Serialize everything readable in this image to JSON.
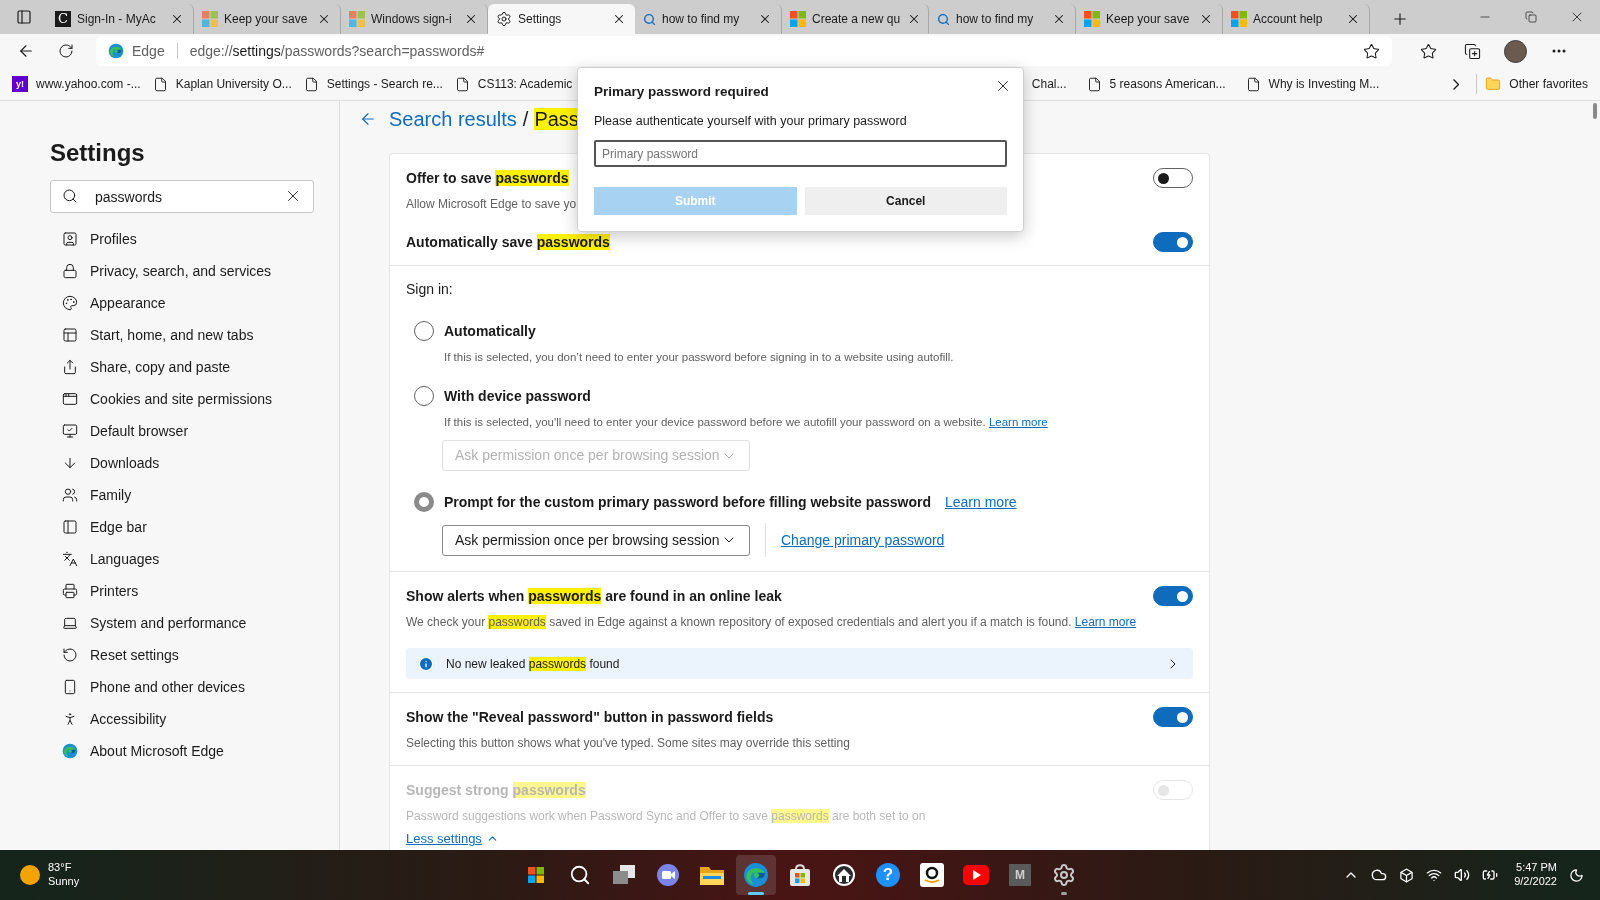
{
  "tabs": [
    {
      "kind": "letter",
      "glyph": "C",
      "title": "Sign-In - MyAc",
      "selected": false
    },
    {
      "kind": "faded-logo",
      "title": "Keep your save",
      "selected": false
    },
    {
      "kind": "faded-logo",
      "title": "Windows sign-i",
      "selected": false
    },
    {
      "kind": "settings",
      "title": "Settings",
      "selected": true
    },
    {
      "kind": "search",
      "title": "how to find my",
      "selected": false
    },
    {
      "kind": "logo",
      "title": "Create a new qu",
      "selected": false
    },
    {
      "kind": "search",
      "title": "how to find my",
      "selected": false
    },
    {
      "kind": "logo",
      "title": "Keep your save",
      "selected": false
    },
    {
      "kind": "logo",
      "title": "Account help",
      "selected": false
    }
  ],
  "address_bar": {
    "site_label": "Edge",
    "url": {
      "scheme": "edge://",
      "host": "settings",
      "path": "/passwords?search=passwords#"
    }
  },
  "bookmarks": {
    "left": [
      {
        "kind": "letter",
        "glyph": "y!",
        "title": "www.yahoo.com -..."
      },
      {
        "kind": "page",
        "title": "Kaplan University O..."
      },
      {
        "kind": "page",
        "title": "Settings - Search re..."
      },
      {
        "kind": "page",
        "title": "CS113: Academic"
      }
    ],
    "right": [
      {
        "kind": "plain",
        "title": "Chal..."
      },
      {
        "kind": "page",
        "title": "5 reasons American..."
      },
      {
        "kind": "page",
        "title": "Why is Investing M..."
      }
    ],
    "other": "Other favorites"
  },
  "sidebar": {
    "title": "Settings",
    "search": {
      "value": "passwords"
    },
    "items": [
      {
        "label": "Profiles",
        "selected": false
      },
      {
        "label": "Privacy, search, and services",
        "selected": false
      },
      {
        "label": "Appearance",
        "selected": false
      },
      {
        "label": "Start, home, and new tabs",
        "selected": false
      },
      {
        "label": "Share, copy and paste",
        "selected": false
      },
      {
        "label": "Cookies and site permissions",
        "selected": false
      },
      {
        "label": "Default browser",
        "selected": false
      },
      {
        "label": "Downloads",
        "selected": false
      },
      {
        "label": "Family",
        "selected": false
      },
      {
        "label": "Edge bar",
        "selected": false
      },
      {
        "label": "Languages",
        "selected": false
      },
      {
        "label": "Printers",
        "selected": false
      },
      {
        "label": "System and performance",
        "selected": false
      },
      {
        "label": "Reset settings",
        "selected": false
      },
      {
        "label": "Phone and other devices",
        "selected": false
      },
      {
        "label": "Accessibility",
        "selected": false
      },
      {
        "label": "About Microsoft Edge",
        "selected": false
      }
    ]
  },
  "breadcrumb": {
    "link": "Search results",
    "separator": "/",
    "current": [
      {
        "text": "Pass",
        "highlight": true
      }
    ]
  },
  "sections": [
    {
      "items": [
        {
          "kind": "toggle",
          "disabled": false,
          "on": false,
          "title": [
            {
              "text": "Offer to save ",
              "highlight": false
            },
            {
              "text": "passwords",
              "highlight": true
            }
          ],
          "description": [
            {
              "text": "Allow Microsoft Edge to save yo",
              "highlight": false
            }
          ]
        },
        {
          "kind": "toggle",
          "disabled": false,
          "on": true,
          "title": [
            {
              "text": "Automatically save ",
              "highlight": false
            },
            {
              "text": "passwords",
              "highlight": true
            }
          ]
        }
      ]
    },
    {
      "items": [
        {
          "kind": "signin",
          "heading": "Sign in:",
          "options": [
            {
              "label": "Automatically",
              "selected": false,
              "description": "If this is selected, you don’t need to enter your password before signing in to a website using autofill."
            },
            {
              "label": "With device password",
              "selected": false,
              "description": "If this is selected, you'll need to enter your device password before we autofill your password on a website.",
              "link": "Learn more",
              "dropdown": {
                "value": "Ask permission once per browsing session",
                "disabled": true
              }
            },
            {
              "label": "Prompt for the custom primary password before filling website password",
              "selected": true,
              "link": "Learn more",
              "dropdown": {
                "value": "Ask permission once per browsing session",
                "disabled": false
              },
              "side_link": "Change primary password"
            }
          ]
        }
      ]
    },
    {
      "items": [
        {
          "kind": "toggle",
          "disabled": false,
          "on": true,
          "title": [
            {
              "text": "Show alerts when ",
              "highlight": false
            },
            {
              "text": "passwords",
              "highlight": true
            },
            {
              "text": " are found in an online leak",
              "highlight": false
            }
          ],
          "description": [
            {
              "text": "We check your ",
              "highlight": false
            },
            {
              "text": "passwords",
              "highlight": true
            },
            {
              "text": " saved in Edge against a known repository of exposed credentials and alert you if a match is found. ",
              "highlight": false
            }
          ],
          "link": "Learn more",
          "banner": [
            {
              "text": "No new leaked ",
              "highlight": false
            },
            {
              "text": "passwords",
              "highlight": true
            },
            {
              "text": " found",
              "highlight": false
            }
          ]
        }
      ]
    },
    {
      "items": [
        {
          "kind": "toggle",
          "disabled": false,
          "on": true,
          "title": [
            {
              "text": "Show the \"Reveal password\" button in password fields",
              "highlight": false
            }
          ],
          "description": [
            {
              "text": "Selecting this button shows what you've typed. Some sites may override this setting",
              "highlight": false
            }
          ]
        }
      ]
    },
    {
      "items": [
        {
          "kind": "toggle",
          "disabled": true,
          "on": false,
          "title": [
            {
              "text": "Suggest strong ",
              "highlight": false
            },
            {
              "text": "passwords",
              "highlight": true
            }
          ],
          "description": [
            {
              "text": "Password suggestions work when Password Sync and Offer to save ",
              "highlight": false
            },
            {
              "text": "passwords",
              "highlight": true
            },
            {
              "text": " are both set to on",
              "highlight": false
            }
          ]
        },
        {
          "kind": "link",
          "label": "Less settings"
        }
      ]
    }
  ],
  "dialog": {
    "title": "Primary password required",
    "message": "Please authenticate yourself with your primary password",
    "field": {
      "placeholder": "Primary password"
    },
    "buttons": [
      {
        "label": "Submit",
        "kind": "primary",
        "disabled": true
      },
      {
        "label": "Cancel",
        "kind": "secondary",
        "disabled": false
      }
    ]
  },
  "taskbar": {
    "weather": {
      "temperature": "83°F",
      "condition": "Sunny"
    },
    "apps": [
      {
        "kind": "start",
        "open": false,
        "focused": false
      },
      {
        "kind": "search",
        "open": false,
        "focused": false
      },
      {
        "kind": "taskview",
        "open": false,
        "focused": false
      },
      {
        "kind": "chat",
        "open": false,
        "focused": false
      },
      {
        "kind": "explorer",
        "open": false,
        "focused": false
      },
      {
        "kind": "edge",
        "open": true,
        "focused": true
      },
      {
        "kind": "store",
        "open": false,
        "focused": false
      },
      {
        "kind": "house",
        "open": false,
        "focused": false
      },
      {
        "kind": "help",
        "glyph": "?",
        "open": false,
        "focused": false
      },
      {
        "kind": "amazon",
        "open": false,
        "focused": false
      },
      {
        "kind": "youtube",
        "open": false,
        "focused": false
      },
      {
        "kind": "mono",
        "glyph": "M",
        "open": false,
        "focused": false
      },
      {
        "kind": "settings",
        "open": true,
        "focused": false
      }
    ],
    "time": "5:47 PM",
    "date": "9/2/2022"
  }
}
